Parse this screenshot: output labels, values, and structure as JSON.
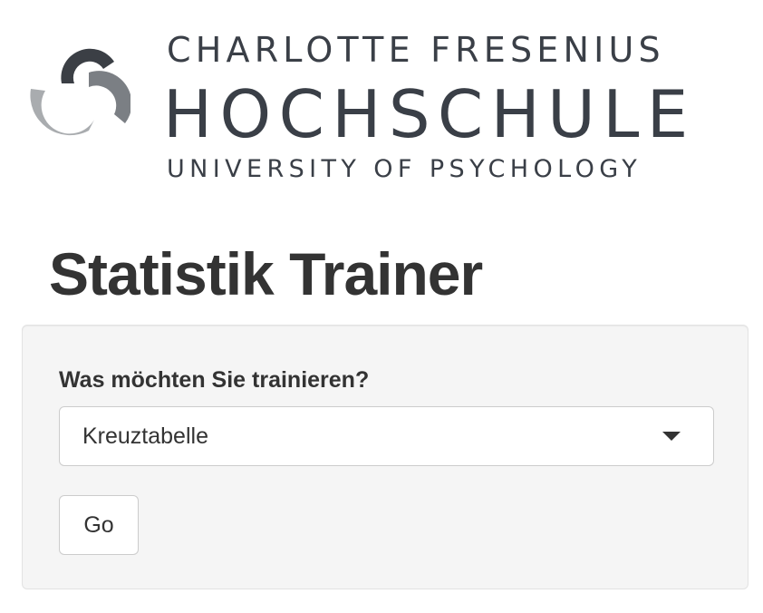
{
  "logo": {
    "line1": "CHARLOTTE FRESENIUS",
    "line2": "HOCHSCHULE",
    "line3": "UNIVERSITY OF PSYCHOLOGY",
    "mark_colors": {
      "dark": "#3b3f45",
      "medium": "#7b7f84",
      "light": "#a9acaf"
    }
  },
  "page": {
    "title": "Statistik Trainer"
  },
  "form": {
    "label": "Was möchten Sie trainieren?",
    "select": {
      "selected": "Kreuztabelle",
      "icon": "caret-down-icon"
    },
    "go_label": "Go"
  },
  "colors": {
    "panel_background": "#f5f5f5",
    "panel_border": "#e3e3e3",
    "text": "#333333",
    "logo_text": "#3a3f47"
  }
}
